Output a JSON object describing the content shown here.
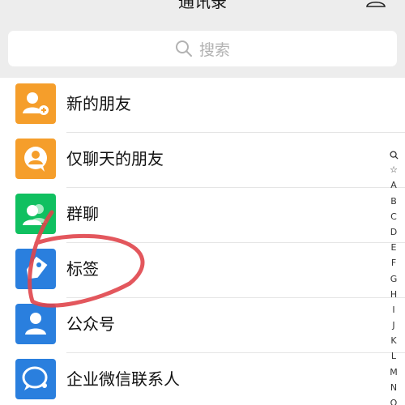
{
  "header": {
    "title": "通讯录"
  },
  "search": {
    "placeholder": "搜索"
  },
  "items": [
    {
      "label": "新的朋友",
      "icon": "new-friend-icon",
      "color": "#f59e2b"
    },
    {
      "label": "仅聊天的朋友",
      "icon": "chat-only-friends-icon",
      "color": "#f59e2b"
    },
    {
      "label": "群聊",
      "icon": "group-chat-icon",
      "color": "#10c060"
    },
    {
      "label": "标签",
      "icon": "tag-icon",
      "color": "#2a7fde"
    },
    {
      "label": "公众号",
      "icon": "official-accounts-icon",
      "color": "#2a7fde"
    },
    {
      "label": "企业微信联系人",
      "icon": "work-wechat-contacts-icon",
      "color": "#2a7fde"
    }
  ],
  "index_letters": [
    "☆",
    "A",
    "B",
    "C",
    "D",
    "E",
    "F",
    "G",
    "H",
    "I",
    "J",
    "K",
    "L",
    "M",
    "N",
    "O"
  ],
  "annotation_color": "#e0454b"
}
